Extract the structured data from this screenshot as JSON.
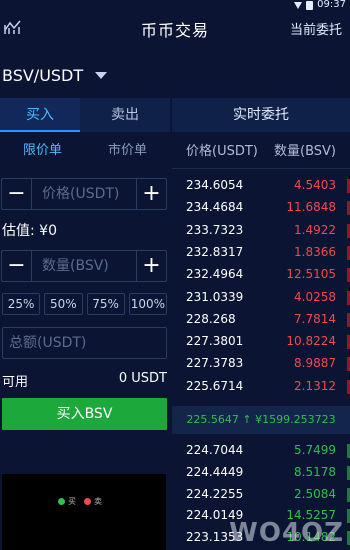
{
  "status_bar": {
    "time": "09:37"
  },
  "header": {
    "title": "币币交易",
    "orders_link": "当前委托"
  },
  "pair": {
    "name": "BSV/USDT"
  },
  "side_tabs": {
    "buy": "买入",
    "sell": "卖出"
  },
  "order_types": {
    "limit": "限价单",
    "market": "市价单"
  },
  "price_input": {
    "placeholder": "价格(USDT)",
    "minus": "−",
    "plus": "+"
  },
  "estimate": {
    "text": "估值: ¥0"
  },
  "amount_input": {
    "placeholder": "数量(BSV)",
    "minus": "−",
    "plus": "+"
  },
  "percent_buttons": [
    "25%",
    "50%",
    "75%",
    "100%"
  ],
  "total_input": {
    "placeholder": "总额(USDT)"
  },
  "available": {
    "label": "可用",
    "value": "0 USDT"
  },
  "buy_button": {
    "label": "买入BSV"
  },
  "mini_chart": {
    "legend_buy": "买",
    "legend_sell": "卖",
    "buy_color": "#2fbf4f",
    "sell_color": "#ef4b4b"
  },
  "order_book": {
    "title": "实时委托",
    "price_header": "价格(USDT)",
    "amount_header": "数量(BSV)",
    "asks": [
      {
        "price": "234.6054",
        "amount": "4.5403"
      },
      {
        "price": "234.4684",
        "amount": "11.6848"
      },
      {
        "price": "233.7323",
        "amount": "1.4922"
      },
      {
        "price": "232.8317",
        "amount": "1.8366"
      },
      {
        "price": "232.4964",
        "amount": "12.5105"
      },
      {
        "price": "231.0339",
        "amount": "4.0258"
      },
      {
        "price": "228.268",
        "amount": "7.7814"
      },
      {
        "price": "227.3801",
        "amount": "10.8224"
      },
      {
        "price": "227.3783",
        "amount": "8.9887"
      },
      {
        "price": "225.6714",
        "amount": "2.1312"
      }
    ],
    "last_trade": "225.5647 ↑ ¥1599.253723",
    "bids": [
      {
        "price": "224.7044",
        "amount": "5.7499"
      },
      {
        "price": "224.4449",
        "amount": "8.5178"
      },
      {
        "price": "224.2255",
        "amount": "2.5084"
      },
      {
        "price": "224.0149",
        "amount": "14.5257"
      },
      {
        "price": "223.1353",
        "amount": "10.1482"
      }
    ]
  },
  "watermark": {
    "text": "WO4OZ"
  },
  "colors": {
    "accent": "#2f8fff",
    "buy": "#1ca83a",
    "ask": "#ef4b4b",
    "bid": "#2fbf4f",
    "background": "#0b1533"
  }
}
